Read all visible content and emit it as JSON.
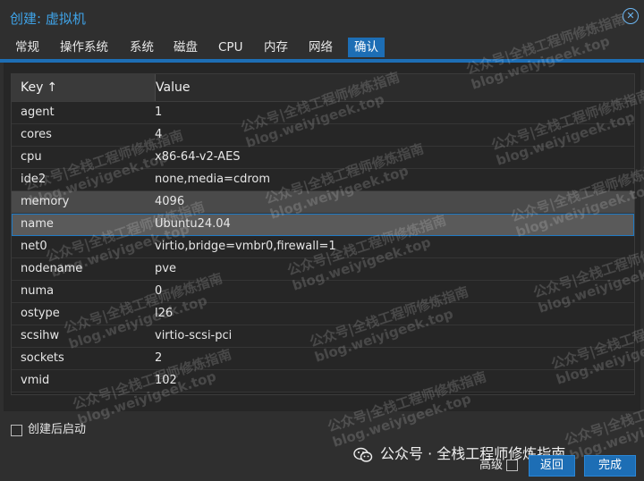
{
  "window": {
    "title": "创建: 虚拟机",
    "close_symbol": "✕"
  },
  "tabs": [
    {
      "label": "常规"
    },
    {
      "label": "操作系统"
    },
    {
      "label": "系统"
    },
    {
      "label": "磁盘"
    },
    {
      "label": "CPU"
    },
    {
      "label": "内存"
    },
    {
      "label": "网络"
    },
    {
      "label": "确认",
      "active": true
    }
  ],
  "grid": {
    "columns": {
      "key": "Key",
      "key_sort_indicator": "↑",
      "value": "Value"
    },
    "rows": [
      {
        "key": "agent",
        "value": "1"
      },
      {
        "key": "cores",
        "value": "4"
      },
      {
        "key": "cpu",
        "value": "x86-64-v2-AES"
      },
      {
        "key": "ide2",
        "value": "none,media=cdrom"
      },
      {
        "key": "memory",
        "value": "4096"
      },
      {
        "key": "name",
        "value": "Ubuntu24.04"
      },
      {
        "key": "net0",
        "value": "virtio,bridge=vmbr0,firewall=1"
      },
      {
        "key": "nodename",
        "value": "pve"
      },
      {
        "key": "numa",
        "value": "0"
      },
      {
        "key": "ostype",
        "value": "l26"
      },
      {
        "key": "scsihw",
        "value": "virtio-scsi-pci"
      },
      {
        "key": "sockets",
        "value": "2"
      },
      {
        "key": "vmid",
        "value": "102"
      }
    ]
  },
  "footer": {
    "start_after_create_label": "创建后启动",
    "advanced_label": "高级",
    "back_label": "返回",
    "finish_label": "完成"
  },
  "watermark": {
    "wechat_text": "公众号 · 全栈工程师修炼指南",
    "line1": "公众号|全栈工程师修炼指南",
    "line2": "blog.weiyigeek.top"
  },
  "colors": {
    "accent": "#1d6eb5",
    "title": "#3fa3e8",
    "background": "#2f2f2f"
  }
}
